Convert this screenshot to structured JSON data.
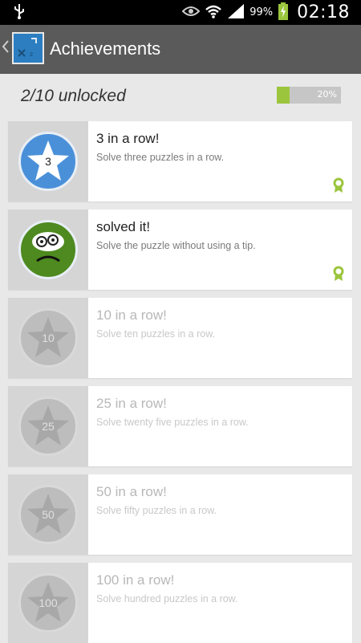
{
  "status_bar": {
    "battery_percent": "99%",
    "time": "02:18"
  },
  "action_bar": {
    "title": "Achievements",
    "icon": "app-icon"
  },
  "progress": {
    "text": "2/10 unlocked",
    "label": "20%",
    "value": 0.2,
    "fill_color": "#9bc53d"
  },
  "achievements": [
    {
      "title": "3 in a row!",
      "description": "Solve three puzzles in a row.",
      "badge": "3",
      "unlocked": true,
      "badge_color": "#4a90d9"
    },
    {
      "title": "solved it!",
      "description": "Solve the puzzle without using a tip.",
      "badge": "",
      "unlocked": true,
      "badge_color": "#4e8a1f"
    },
    {
      "title": "10 in a row!",
      "description": "Solve ten puzzles in a row.",
      "badge": "10",
      "unlocked": false
    },
    {
      "title": "25 in a row!",
      "description": "Solve twenty five puzzles in a row.",
      "badge": "25",
      "unlocked": false
    },
    {
      "title": "50 in a row!",
      "description": "Solve fifty puzzles in a row.",
      "badge": "50",
      "unlocked": false
    },
    {
      "title": "100 in a row!",
      "description": "Solve hundred puzzles in a row.",
      "badge": "100",
      "unlocked": false
    }
  ]
}
